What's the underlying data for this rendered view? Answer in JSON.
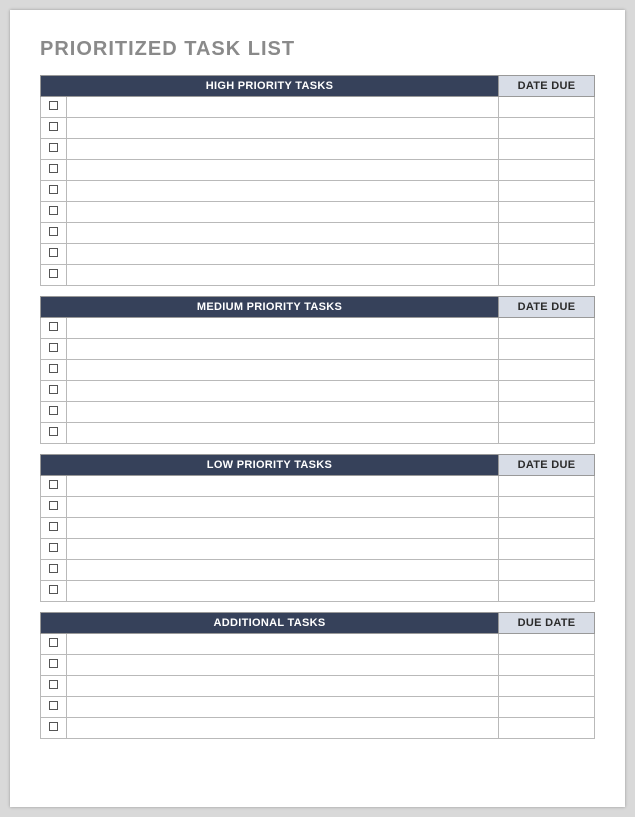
{
  "title": "PRIORITIZED TASK LIST",
  "sections": [
    {
      "task_header": "HIGH PRIORITY TASKS",
      "date_header": "DATE DUE",
      "rows": [
        {
          "task": "",
          "date": ""
        },
        {
          "task": "",
          "date": ""
        },
        {
          "task": "",
          "date": ""
        },
        {
          "task": "",
          "date": ""
        },
        {
          "task": "",
          "date": ""
        },
        {
          "task": "",
          "date": ""
        },
        {
          "task": "",
          "date": ""
        },
        {
          "task": "",
          "date": ""
        },
        {
          "task": "",
          "date": ""
        }
      ]
    },
    {
      "task_header": "MEDIUM PRIORITY TASKS",
      "date_header": "DATE DUE",
      "rows": [
        {
          "task": "",
          "date": ""
        },
        {
          "task": "",
          "date": ""
        },
        {
          "task": "",
          "date": ""
        },
        {
          "task": "",
          "date": ""
        },
        {
          "task": "",
          "date": ""
        },
        {
          "task": "",
          "date": ""
        }
      ]
    },
    {
      "task_header": "LOW PRIORITY TASKS",
      "date_header": "DATE DUE",
      "rows": [
        {
          "task": "",
          "date": ""
        },
        {
          "task": "",
          "date": ""
        },
        {
          "task": "",
          "date": ""
        },
        {
          "task": "",
          "date": ""
        },
        {
          "task": "",
          "date": ""
        },
        {
          "task": "",
          "date": ""
        }
      ]
    },
    {
      "task_header": "ADDITIONAL TASKS",
      "date_header": "DUE DATE",
      "rows": [
        {
          "task": "",
          "date": ""
        },
        {
          "task": "",
          "date": ""
        },
        {
          "task": "",
          "date": ""
        },
        {
          "task": "",
          "date": ""
        },
        {
          "task": "",
          "date": ""
        }
      ]
    }
  ]
}
